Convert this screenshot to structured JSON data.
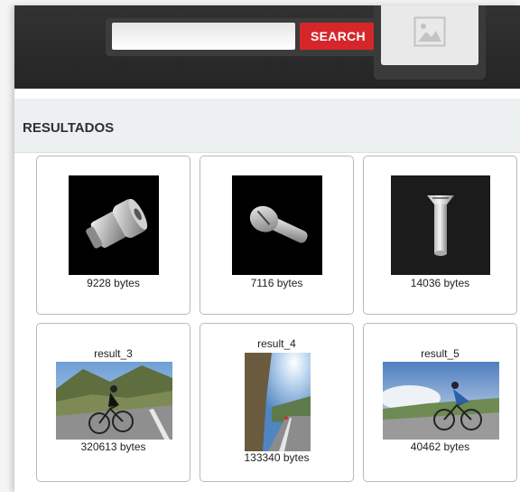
{
  "search": {
    "placeholder": "",
    "value": "",
    "button_label": "SEARCH"
  },
  "upload": {
    "icon": "image-placeholder-icon"
  },
  "results": {
    "title": "RESULTADOS",
    "items": [
      {
        "name": "",
        "size": "9228 bytes",
        "thumbnail": "bolt-render"
      },
      {
        "name": "",
        "size": "7116 bytes",
        "thumbnail": "screw-render"
      },
      {
        "name": "",
        "size": "14036 bytes",
        "thumbnail": "countersunk-screw-render"
      },
      {
        "name": "result_3",
        "size": "320613 bytes",
        "thumbnail": "cyclist-photo"
      },
      {
        "name": "result_4",
        "size": "133340 bytes",
        "thumbnail": "cyclist-road-photo"
      },
      {
        "name": "result_5",
        "size": "40462 bytes",
        "thumbnail": "cyclist-photo"
      }
    ]
  },
  "colors": {
    "accent": "#d6262b",
    "header": "#2b2b2b",
    "panel": "#ecf0f0"
  }
}
